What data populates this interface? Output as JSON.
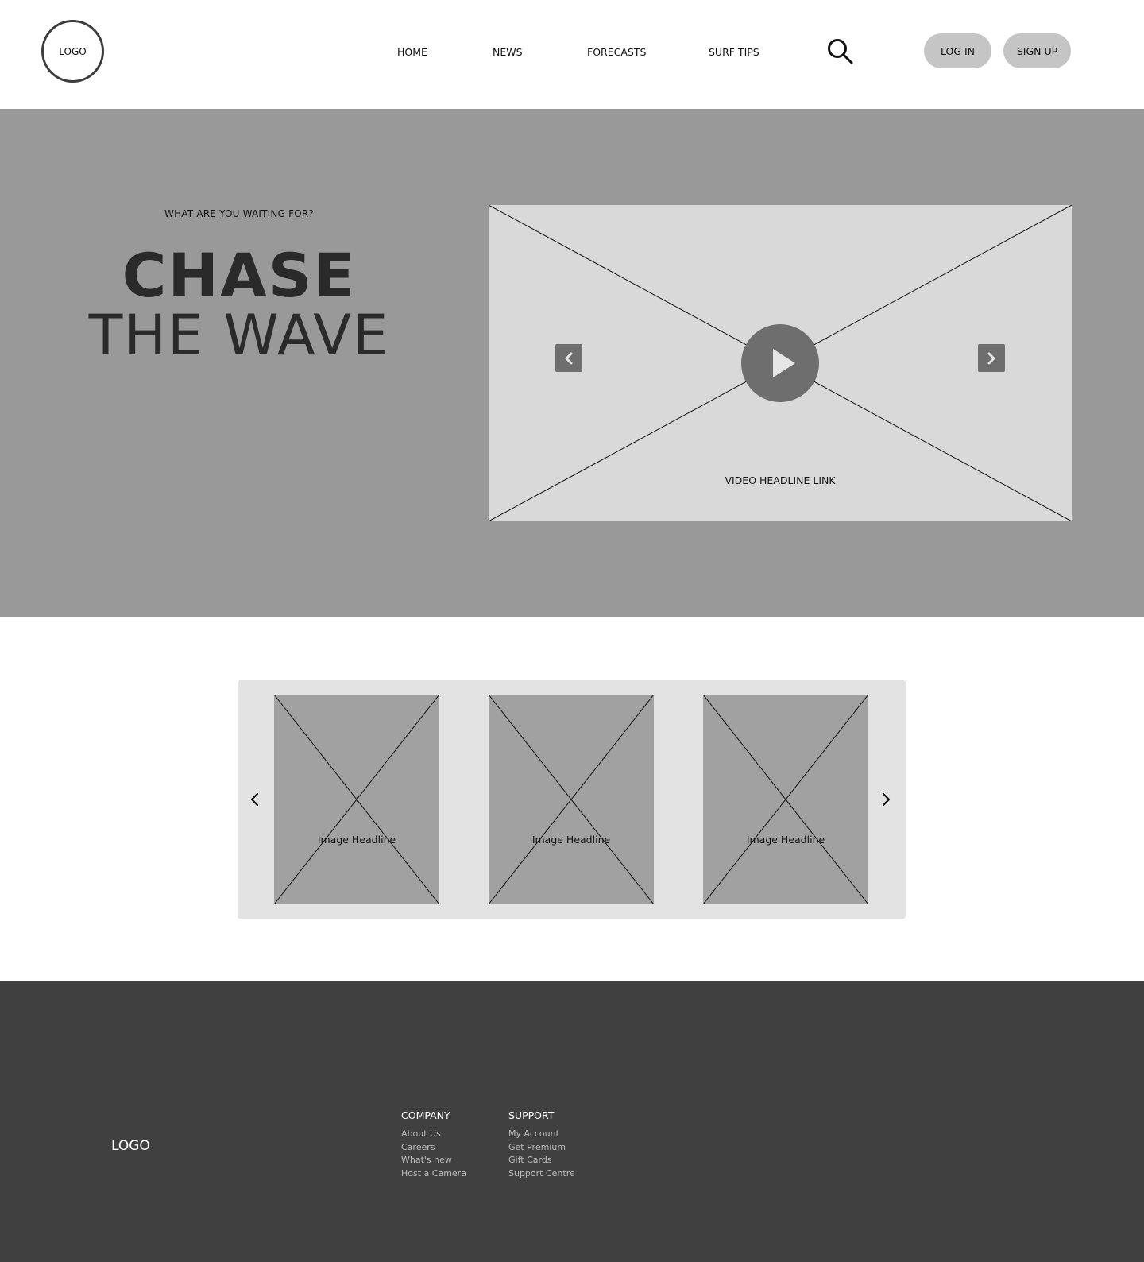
{
  "header": {
    "logo_text": "LOGO",
    "nav": [
      {
        "label": "HOME"
      },
      {
        "label": "NEWS"
      },
      {
        "label": "FORECASTS"
      },
      {
        "label": "SURF TIPS"
      }
    ],
    "login_label": "LOG IN",
    "signup_label": "SIGN UP"
  },
  "hero": {
    "eyebrow": "WHAT ARE YOU WAITING FOR?",
    "headline_line1": "CHASE",
    "headline_line2": "THE WAVE",
    "video_headline": "VIDEO HEADLINE LINK"
  },
  "carousel": {
    "cards": [
      {
        "headline": "Image Headline"
      },
      {
        "headline": "Image Headline"
      },
      {
        "headline": "Image Headline"
      }
    ]
  },
  "footer": {
    "logo_text": "LOGO",
    "company": {
      "title": "COMPANY",
      "links": [
        "About Us",
        "Careers",
        "What's new",
        "Host a Camera"
      ]
    },
    "support": {
      "title": "SUPPORT",
      "links": [
        "My Account",
        "Get Premium",
        "Gift Cards",
        "Support Centre"
      ]
    }
  },
  "colors": {
    "hero_bg": "#999999",
    "video_bg": "#d9d9d9",
    "control_gray": "#6e6e6e",
    "pill_bg": "#c5c5c5",
    "carousel_bg": "#e3e3e3",
    "card_bg": "#a1a1a1",
    "footer_bg": "#404040"
  }
}
